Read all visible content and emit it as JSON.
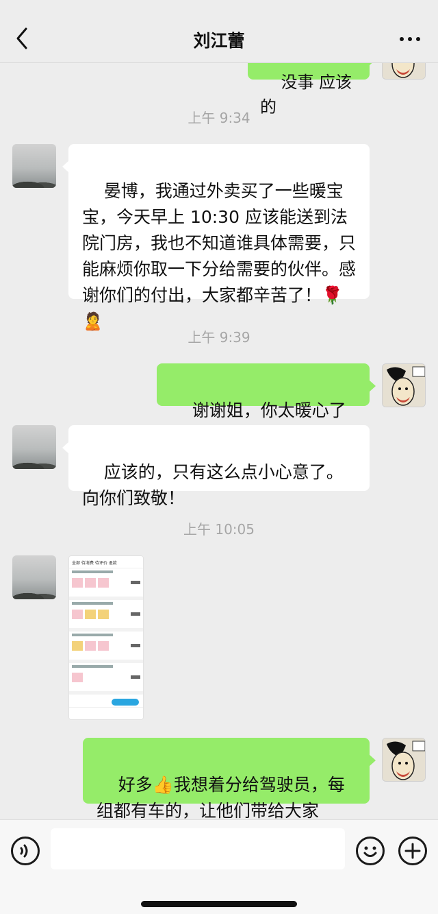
{
  "header": {
    "title": "刘江蕾"
  },
  "messages": {
    "partial_top": "没事 应该的",
    "ts1": "上午 9:34",
    "m1": "晏博，我通过外卖买了一些暖宝宝，今天早上 10:30 应该能送到法院门房，我也不知道谁具体需要，只能麻烦你取一下分给需要的伙伴。感谢你们的付出，大家都辛苦了！🌹🙎",
    "ts2": "上午 9:39",
    "m2": "谢谢姐，你太暖心了❤️",
    "m3": "应该的，只有这么点小心意了。向你们致敬！",
    "ts3": "上午 10:05",
    "m4": "好多👍我想着分给驾驶员，每组都有车的，让他们带给大家"
  },
  "shared_image": {
    "tabs": "全部  待消费  待评价  退款"
  },
  "colors": {
    "background": "#ededed",
    "bubble_self": "#95ec69",
    "bubble_other": "#ffffff",
    "timestamp": "#a6a6a6"
  },
  "icons": {
    "back": "chevron-left-icon",
    "more": "ellipsis-icon",
    "voice": "voice-icon",
    "emoji": "smiley-icon",
    "add": "plus-icon"
  }
}
